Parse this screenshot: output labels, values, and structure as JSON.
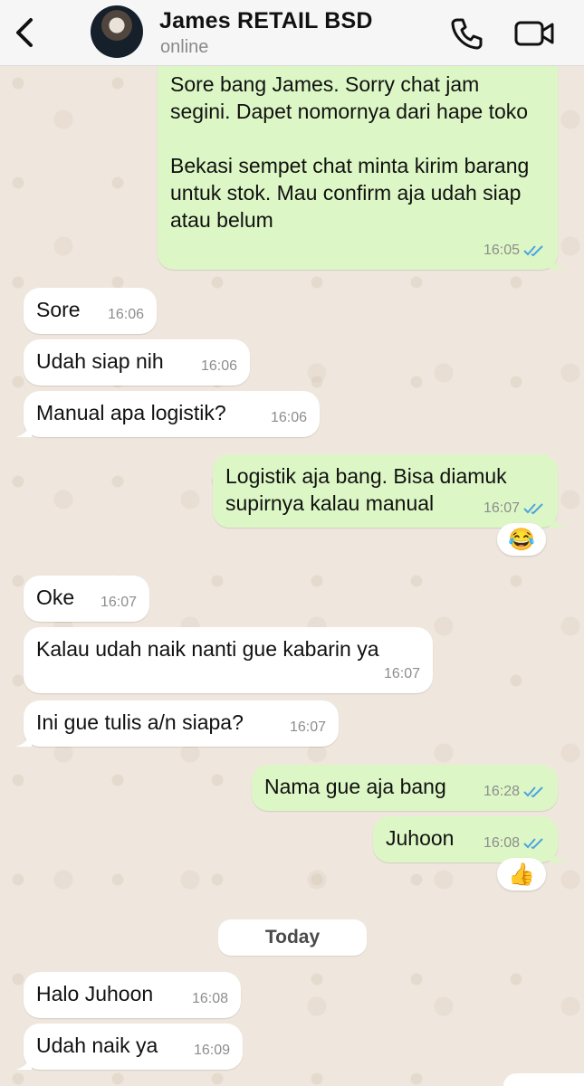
{
  "header": {
    "contact_name": "James RETAIL BSD",
    "status": "online"
  },
  "colors": {
    "incoming_bubble": "#ffffff",
    "outgoing_bubble": "#dcf7c5",
    "read_ticks": "#4fa3e0",
    "wallpaper": "#efe7dd"
  },
  "icons": [
    "chevron-left-icon",
    "avatar",
    "phone-icon",
    "video-camera-icon",
    "double-check-icon"
  ],
  "messages": [
    {
      "dir": "out",
      "text": "Sore bang James. Sorry chat jam segini. Dapet nomornya dari hape toko\n\nBekasi sempet chat minta kirim barang untuk stok. Mau confirm aja udah siap atau belum",
      "time": "16:05"
    },
    {
      "dir": "in",
      "text": "Sore",
      "time": "16:06"
    },
    {
      "dir": "in",
      "text": "Udah siap nih",
      "time": "16:06"
    },
    {
      "dir": "in",
      "text": "Manual apa logistik?",
      "time": "16:06"
    },
    {
      "dir": "out",
      "text": "Logistik aja bang. Bisa diamuk supirnya kalau manual",
      "time": "16:07",
      "reaction": "😂"
    },
    {
      "dir": "in",
      "text": "Oke",
      "time": "16:07"
    },
    {
      "dir": "in",
      "text": "Kalau udah naik nanti gue kabarin ya",
      "time": "16:07"
    },
    {
      "dir": "in",
      "text": "Ini gue tulis a/n siapa?",
      "time": "16:07"
    },
    {
      "dir": "out",
      "text": "Nama gue aja bang",
      "time": "16:28"
    },
    {
      "dir": "out",
      "text": "Juhoon",
      "time": "16:08",
      "reaction": "👍"
    },
    {
      "dir": "in",
      "text": "Halo Juhoon",
      "time": "16:08"
    },
    {
      "dir": "in",
      "text": "Udah naik ya",
      "time": "16:09"
    }
  ],
  "date_separator": "Today"
}
